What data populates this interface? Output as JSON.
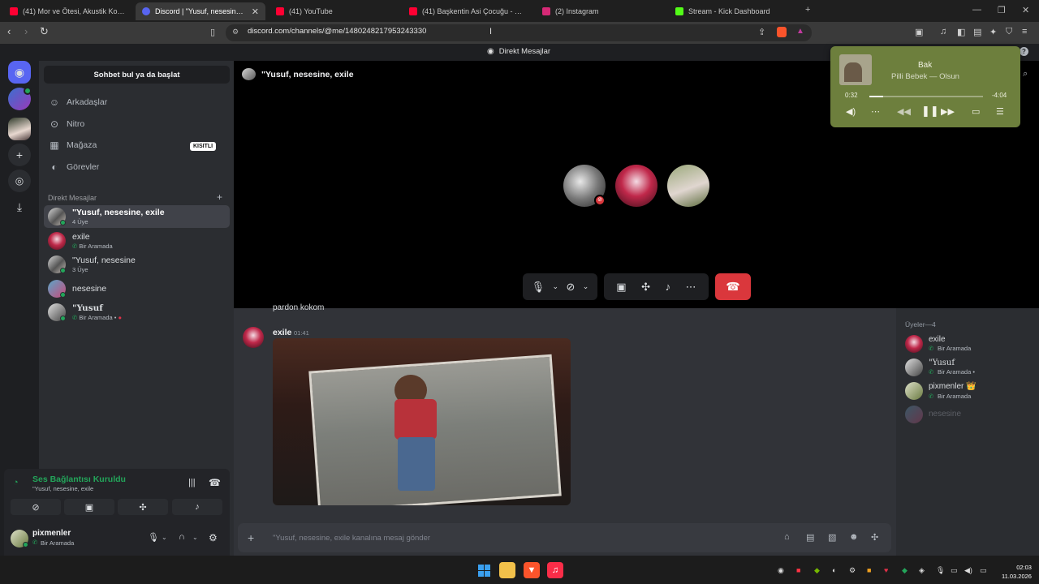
{
  "browser": {
    "tabs": [
      {
        "title": "(41) Mor ve Ötesi, Akustik Konser, Ba",
        "icon": "youtube-icon",
        "color": "#ff0033"
      },
      {
        "title": "Discord | \"Yusuf, nesesine, e",
        "icon": "discord-icon",
        "color": "#5865f2"
      },
      {
        "title": "(41) YouTube",
        "icon": "youtube-icon",
        "color": "#ff0033"
      },
      {
        "title": "(41) Başkentin Asi Çocuğu - YouTube",
        "icon": "youtube-icon",
        "color": "#ff0033"
      },
      {
        "title": "(2) Instagram",
        "icon": "instagram-icon",
        "color": "#d62976"
      },
      {
        "title": "Stream - Kick Dashboard",
        "icon": "kick-icon",
        "color": "#53fc18"
      }
    ],
    "url": "discord.com/channels/@me/1480248217953243330"
  },
  "discord": {
    "window_title": "Direkt Mesajlar",
    "search_placeholder": "Sohbet bul ya da başlat",
    "nav": [
      {
        "label": "Arkadaşlar",
        "icon": "friends-icon"
      },
      {
        "label": "Nitro",
        "icon": "nitro-icon"
      },
      {
        "label": "Mağaza",
        "icon": "shop-icon",
        "badge": "KISITLI"
      },
      {
        "label": "Görevler",
        "icon": "quests-icon"
      }
    ],
    "dm_header": "Direkt Mesajlar",
    "dms": [
      {
        "name": "\"Yusuf, nesesine, exile",
        "sub": "4 Üye"
      },
      {
        "name": "exile",
        "sub": "Bir Aramada"
      },
      {
        "name": "\"Yusuf, nesesine",
        "sub": "3 Üye"
      },
      {
        "name": "nesesine",
        "sub": ""
      },
      {
        "name": "\"Yusuf",
        "sub": "Bir Aramada •"
      }
    ],
    "voice": {
      "title": "Ses Bağlantısı Kuruldu",
      "channel": "\"Yusuf, nesesine, exile"
    },
    "user": {
      "name": "pixmenler",
      "status": "Bir Aramada"
    },
    "call": {
      "title": "\"Yusuf, nesesine, exile"
    },
    "chat": {
      "prev_message": "pardon kokom",
      "message": {
        "author": "exile",
        "time": "01:41"
      },
      "input_placeholder": "\"Yusuf, nesesine, exile kanalına mesaj gönder"
    },
    "members": {
      "header": "Üyeler—4",
      "list": [
        {
          "name": "exile",
          "sub": "Bir Aramada"
        },
        {
          "name": "\"Yusuf",
          "sub": "Bir Aramada •"
        },
        {
          "name": "pixmenler 👑",
          "sub": "Bir Aramada"
        },
        {
          "name": "nesesine",
          "sub": ""
        }
      ]
    }
  },
  "music": {
    "title": "Bak",
    "artist": "Pilli Bebek — Olsun",
    "elapsed": "0:32",
    "remaining": "-4:04",
    "progress": 0.12
  },
  "taskbar": {
    "time": "02:03",
    "date": "11.03.2026"
  }
}
